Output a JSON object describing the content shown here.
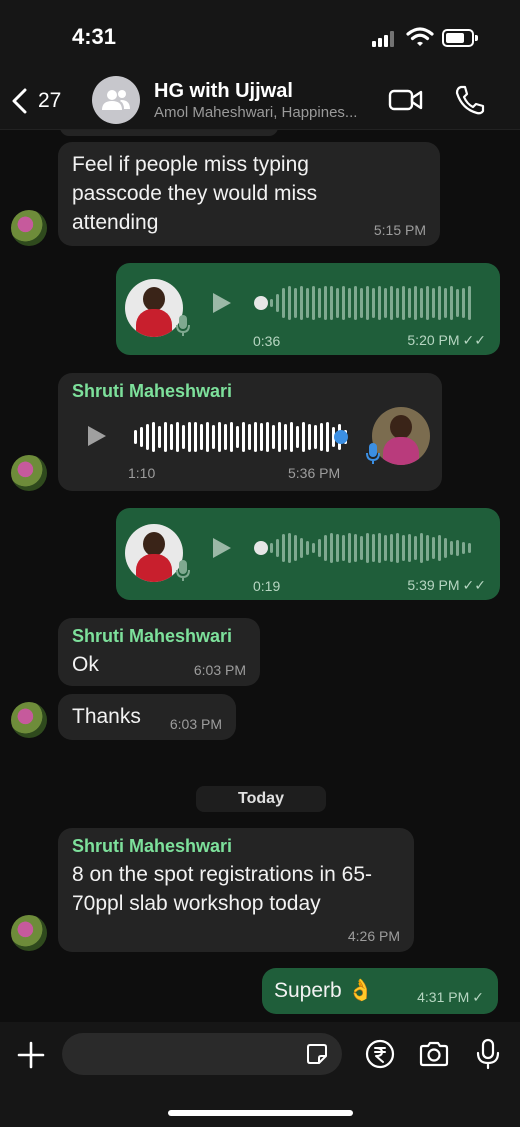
{
  "status_bar": {
    "time": "4:31"
  },
  "header": {
    "back_count": "27",
    "title": "HG with Ujjwal",
    "subtitle": "Amol Maheshwari, Happines..."
  },
  "messages": [
    {
      "type": "text",
      "direction": "in",
      "text": "Feel if people miss typing passcode they would miss attending",
      "time": "5:15 PM"
    },
    {
      "type": "voice",
      "direction": "out",
      "duration": "0:36",
      "time": "5:20 PM",
      "status": "read"
    },
    {
      "type": "voice",
      "direction": "in",
      "sender": "Shruti Maheshwari",
      "duration": "1:10",
      "time": "5:36 PM"
    },
    {
      "type": "voice",
      "direction": "out",
      "duration": "0:19",
      "time": "5:39 PM",
      "status": "read"
    },
    {
      "type": "text",
      "direction": "in",
      "sender": "Shruti Maheshwari",
      "text": "Ok",
      "time": "6:03 PM"
    },
    {
      "type": "text",
      "direction": "in",
      "text": "Thanks",
      "time": "6:03 PM"
    },
    {
      "type": "text",
      "direction": "in",
      "sender": "Shruti Maheshwari",
      "text": "8 on the spot registrations in 65-70ppl slab workshop today",
      "time": "4:26 PM"
    },
    {
      "type": "text",
      "direction": "out",
      "text": "Superb 👌",
      "time": "4:31 PM",
      "status": "sent"
    }
  ],
  "day_divider": "Today",
  "input": {
    "placeholder": ""
  },
  "colors": {
    "incoming_bubble": "#242424",
    "outgoing_bubble": "#1f5e3a",
    "sender_name": "#7de09b",
    "read_tick": "#b7d6c2",
    "playhead_blue": "#3b8fe3"
  },
  "icons": [
    "back-chevron-icon",
    "group-avatar-icon",
    "video-call-icon",
    "phone-icon",
    "play-icon",
    "mic-icon",
    "plus-icon",
    "sticker-icon",
    "rupee-icon",
    "camera-icon",
    "microphone-icon"
  ]
}
